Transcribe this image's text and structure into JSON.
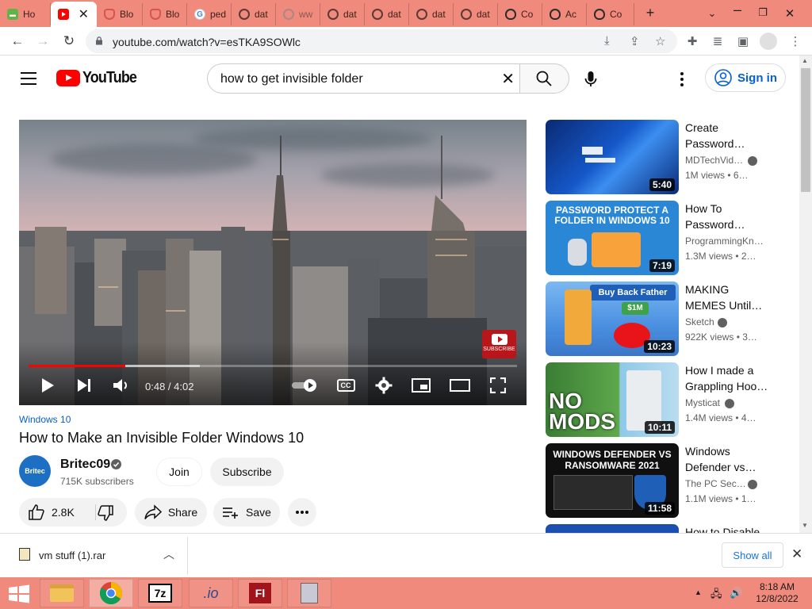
{
  "browser": {
    "tabs": [
      {
        "icon": "green-app-icon",
        "title": "Ho"
      },
      {
        "icon": "youtube-icon",
        "title": ""
      },
      {
        "icon": "brave-icon",
        "title": "Blo"
      },
      {
        "icon": "brave-icon",
        "title": "Blo"
      },
      {
        "icon": "google-icon",
        "title": "ped"
      },
      {
        "icon": "globe-icon",
        "title": "dat"
      },
      {
        "icon": "globe-icon",
        "title": "ww"
      },
      {
        "icon": "globe-icon",
        "title": "dat"
      },
      {
        "icon": "globe-icon",
        "title": "dat"
      },
      {
        "icon": "globe-icon",
        "title": "dat"
      },
      {
        "icon": "globe-icon",
        "title": "dat"
      },
      {
        "icon": "cat-icon",
        "title": "Co"
      },
      {
        "icon": "cat-icon",
        "title": "Ac"
      },
      {
        "icon": "cat-icon",
        "title": "Co"
      }
    ],
    "url": "youtube.com/watch?v=esTKA9SOWlc"
  },
  "youtube": {
    "logo_text": "YouTube",
    "search_query": "how to get invisible folder",
    "signin_label": "Sign in"
  },
  "player": {
    "time_display": "0:48 / 4:02",
    "progress_fraction": 0.198,
    "buffered_fraction": 0.35,
    "watermark_text": "SUBSCRIBE",
    "cc_label": "CC"
  },
  "video": {
    "hashtag": "Windows 10",
    "title": "How to Make an Invisible Folder Windows 10",
    "channel": "Britec09",
    "avatar_text": "Britec",
    "subscribers": "715K subscribers",
    "join_label": "Join",
    "subscribe_label": "Subscribe",
    "likes": "2.8K",
    "share_label": "Share",
    "save_label": "Save"
  },
  "related": [
    {
      "title_line1": "Create",
      "title_line2": "Password…",
      "channel": "MDTechVid…",
      "verified": true,
      "stats": "1M views  • 6…",
      "duration": "5:40",
      "thumb_text": ""
    },
    {
      "title_line1": "How To",
      "title_line2": "Password…",
      "channel": "ProgrammingKn…",
      "verified": false,
      "stats": "1.3M views  • 2…",
      "duration": "7:19",
      "thumb_text": "PASSWORD PROTECT A FOLDER IN WINDOWS 10"
    },
    {
      "title_line1": "MAKING",
      "title_line2": "MEMES Until…",
      "channel": "Sketch",
      "verified": true,
      "stats": "922K views  • 3…",
      "duration": "10:23",
      "thumb_text": "Buy Back Father",
      "thumb_sub": "$1M"
    },
    {
      "title_line1": "How I made a",
      "title_line2": "Grappling Hoo…",
      "channel": "Mysticat",
      "verified": true,
      "stats": "1.4M views  • 4…",
      "duration": "10:11",
      "thumb_text": "NO MODS"
    },
    {
      "title_line1": "Windows",
      "title_line2": "Defender vs…",
      "channel": "The PC Sec…",
      "verified": true,
      "stats": "1.1M views  • 1…",
      "duration": "11:58",
      "thumb_text": "WINDOWS DEFENDER VS RANSOMWARE 2021"
    },
    {
      "title_line1": "How to Disable",
      "title_line2": "",
      "channel": "",
      "verified": false,
      "stats": "",
      "duration": "",
      "thumb_text": ""
    }
  ],
  "downloads": {
    "filename": "vm stuff (1).rar",
    "show_all_label": "Show all"
  },
  "taskbar": {
    "apps": [
      "file-explorer-icon",
      "chrome-icon",
      "7zip-icon",
      "jio-icon",
      "flash-icon",
      "archive-icon"
    ],
    "sevenzip_label": "7z",
    "flash_label": "Fl",
    "time": "8:18 AM",
    "date": "12/8/2022"
  },
  "colors": {
    "chrome_frame": "#ef8a7c",
    "youtube_red": "#ff0000",
    "link_blue": "#065fd4"
  }
}
